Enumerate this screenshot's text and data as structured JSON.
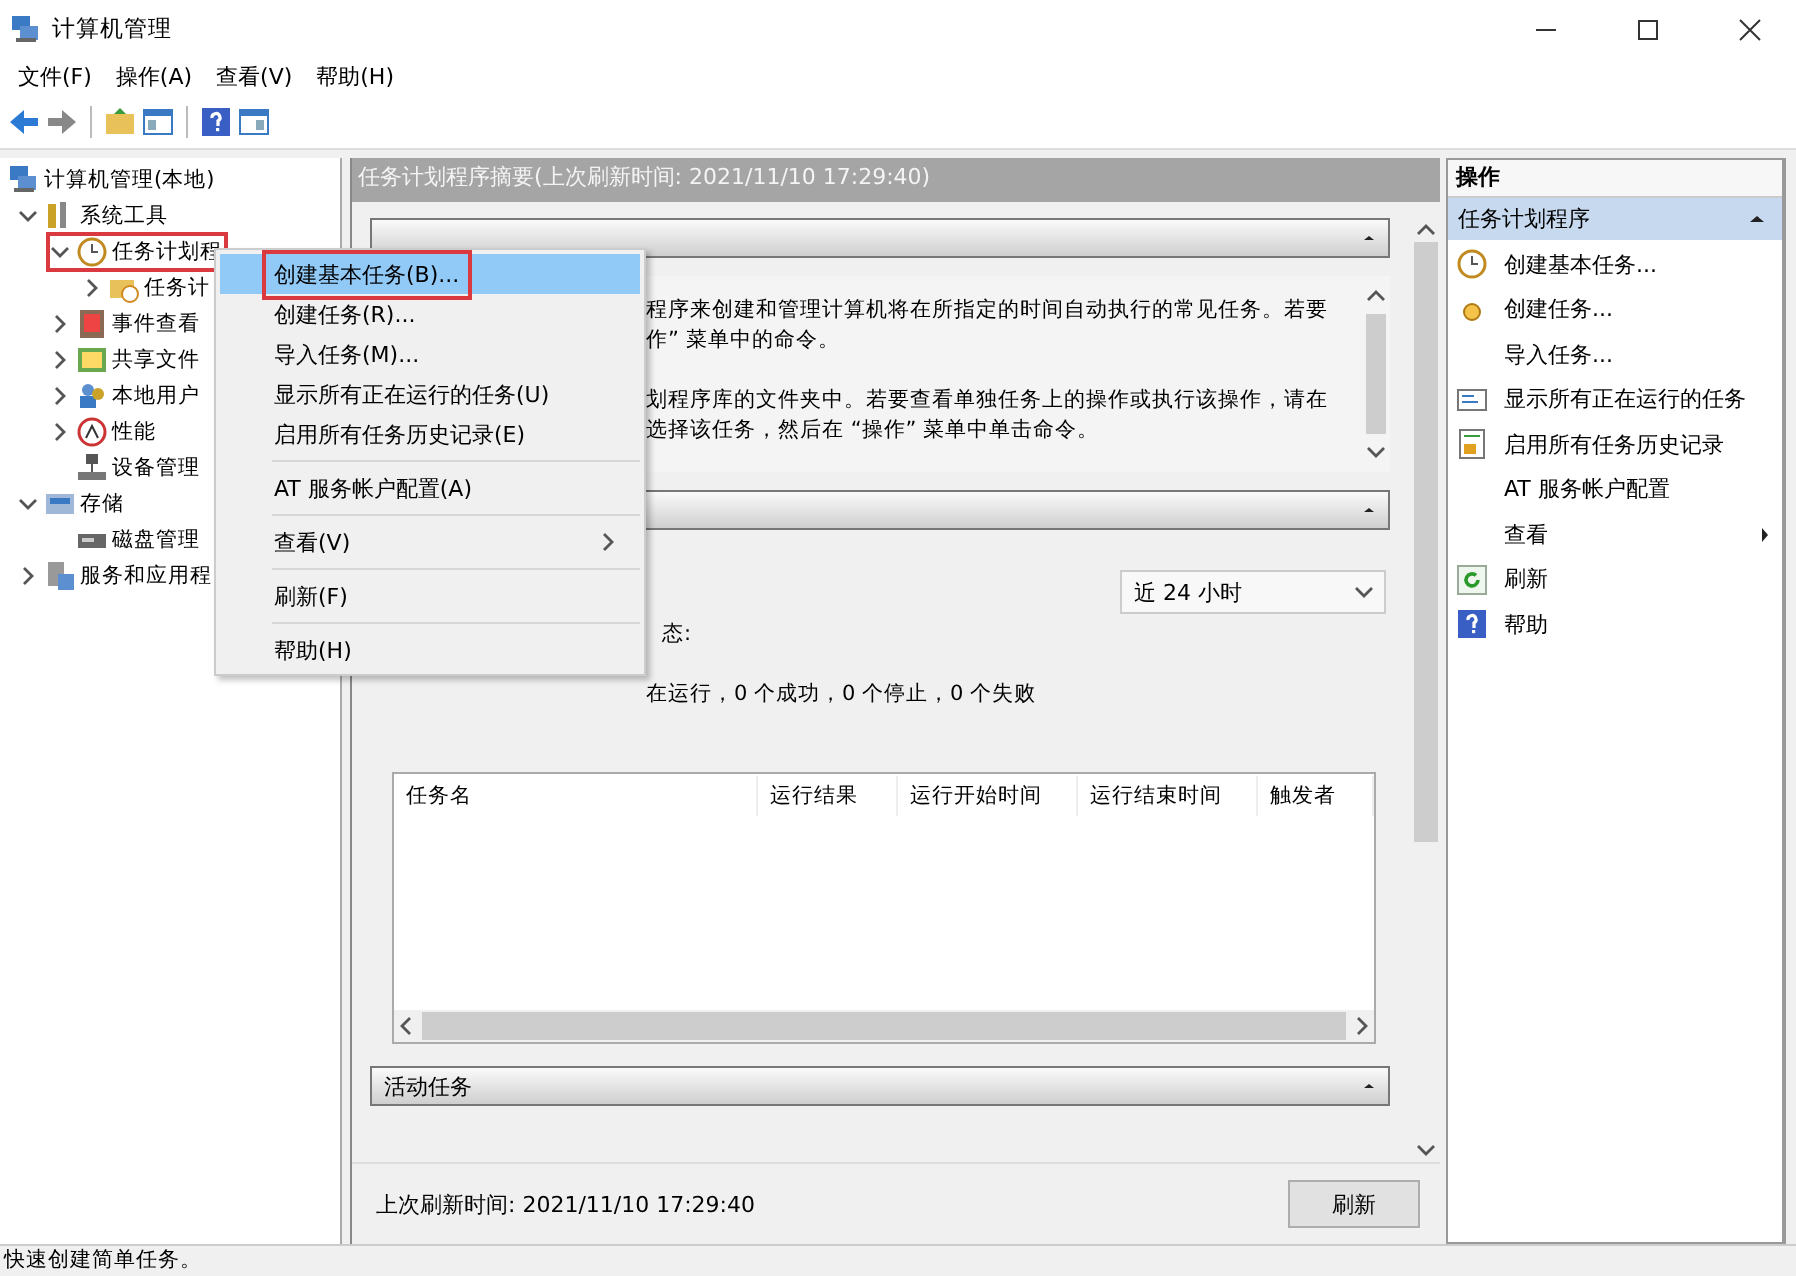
{
  "window": {
    "title": "计算机管理"
  },
  "menu_bar": [
    "文件(F)",
    "操作(A)",
    "查看(V)",
    "帮助(H)"
  ],
  "tree": [
    {
      "label": "计算机管理(本地)",
      "annotated": false,
      "children": [
        {
          "label": "系统工具",
          "expanded": true,
          "annotated": false,
          "children": [
            {
              "label": "任务计划程",
              "expanded": true,
              "annotated": true,
              "children": [
                {
                  "label": "任务计",
                  "expanded": false,
                  "annotated": false
                }
              ]
            },
            {
              "label": "事件查看",
              "expanded": false,
              "annotated": false
            },
            {
              "label": "共享文件",
              "expanded": false,
              "annotated": false
            },
            {
              "label": "本地用户",
              "expanded": false,
              "annotated": false
            },
            {
              "label": "性能",
              "expanded": false,
              "annotated": false
            },
            {
              "label": "设备管理",
              "annotated": false
            }
          ]
        },
        {
          "label": "存储",
          "expanded": true,
          "annotated": false,
          "children": [
            {
              "label": "磁盘管理",
              "annotated": false
            }
          ]
        },
        {
          "label": "服务和应用程",
          "expanded": false,
          "annotated": false
        }
      ]
    }
  ],
  "summary": {
    "title": "任务计划程序摘要(上次刷新时间: 2021/11/10 17:29:40)",
    "sections": [
      {
        "kind": "overview",
        "expanded": true,
        "paragraphs": [
          [
            "程序来创建和管理计算机将在所指定的时间自动执行的常见任务。若要",
            "作” 菜单中的命令。"
          ],
          [
            "划程序库的文件夹中。若要查看单独任务上的操作或执行该操作，请在",
            "选择该任务，然后在 “操作” 菜单中单击命令。"
          ]
        ]
      },
      {
        "kind": "status",
        "expanded": true,
        "status_label": "态:",
        "period": "近 24 小时",
        "counts": "在运行，0 个成功，0 个停止，0 个失败",
        "columns": [
          "任务名",
          "运行结果",
          "运行开始时间",
          "运行结束时间",
          "触发者"
        ]
      },
      {
        "kind": "active",
        "expanded": true,
        "title": "活动任务"
      }
    ],
    "last_refresh": "上次刷新时间: 2021/11/10 17:29:40",
    "refresh_button": "刷新"
  },
  "actions": {
    "header": "操作",
    "group": {
      "title": "任务计划程序",
      "expanded": true
    },
    "items": [
      {
        "label": "创建基本任务...",
        "submenu": false
      },
      {
        "label": "创建任务...",
        "submenu": false
      },
      {
        "label": "导入任务...",
        "submenu": false
      },
      {
        "label": "显示所有正在运行的任务",
        "submenu": false
      },
      {
        "label": "启用所有任务历史记录",
        "submenu": false
      },
      {
        "label": "AT 服务帐户配置",
        "submenu": false
      },
      {
        "label": "查看",
        "submenu": true
      },
      {
        "label": "刷新",
        "submenu": false
      },
      {
        "label": "帮助",
        "submenu": false
      }
    ]
  },
  "context_menu": {
    "items": [
      {
        "kind": "item",
        "label": "创建基本任务(B)...",
        "selected": true,
        "annotated": true,
        "submenu": false
      },
      {
        "kind": "item",
        "label": "创建任务(R)...",
        "selected": false,
        "annotated": false,
        "submenu": false
      },
      {
        "kind": "item",
        "label": "导入任务(M)...",
        "selected": false,
        "annotated": false,
        "submenu": false
      },
      {
        "kind": "item",
        "label": "显示所有正在运行的任务(U)",
        "selected": false,
        "annotated": false,
        "submenu": false
      },
      {
        "kind": "item",
        "label": "启用所有任务历史记录(E)",
        "selected": false,
        "annotated": false,
        "submenu": false
      },
      {
        "kind": "separator"
      },
      {
        "kind": "item",
        "label": "AT 服务帐户配置(A)",
        "selected": false,
        "annotated": false,
        "submenu": false
      },
      {
        "kind": "separator"
      },
      {
        "kind": "item",
        "label": "查看(V)",
        "selected": false,
        "annotated": false,
        "submenu": true
      },
      {
        "kind": "separator"
      },
      {
        "kind": "item",
        "label": "刷新(F)",
        "selected": false,
        "annotated": false,
        "submenu": false
      },
      {
        "kind": "separator"
      },
      {
        "kind": "item",
        "label": "帮助(H)",
        "selected": false,
        "annotated": false,
        "submenu": false
      }
    ]
  },
  "status_bar": "快速创建简单任务。"
}
